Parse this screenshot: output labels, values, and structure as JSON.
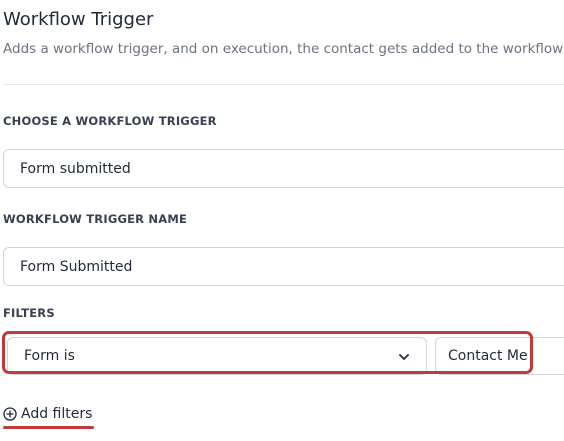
{
  "header": {
    "title": "Workflow Trigger",
    "subtitle": "Adds a workflow trigger, and on execution, the contact gets added to the workflow"
  },
  "trigger_select": {
    "label": "CHOOSE A WORKFLOW TRIGGER",
    "value": "Form submitted"
  },
  "trigger_name": {
    "label": "WORKFLOW TRIGGER NAME",
    "value": "Form Submitted"
  },
  "filters": {
    "label": "FILTERS",
    "items": [
      {
        "field": "Form is",
        "value": "Contact Me",
        "icon": "chevron-down-icon"
      }
    ],
    "add_label": "Add filters",
    "add_icon": "plus-circle-icon"
  },
  "colors": {
    "highlight": "#c0393b",
    "border": "#d1d5db"
  }
}
